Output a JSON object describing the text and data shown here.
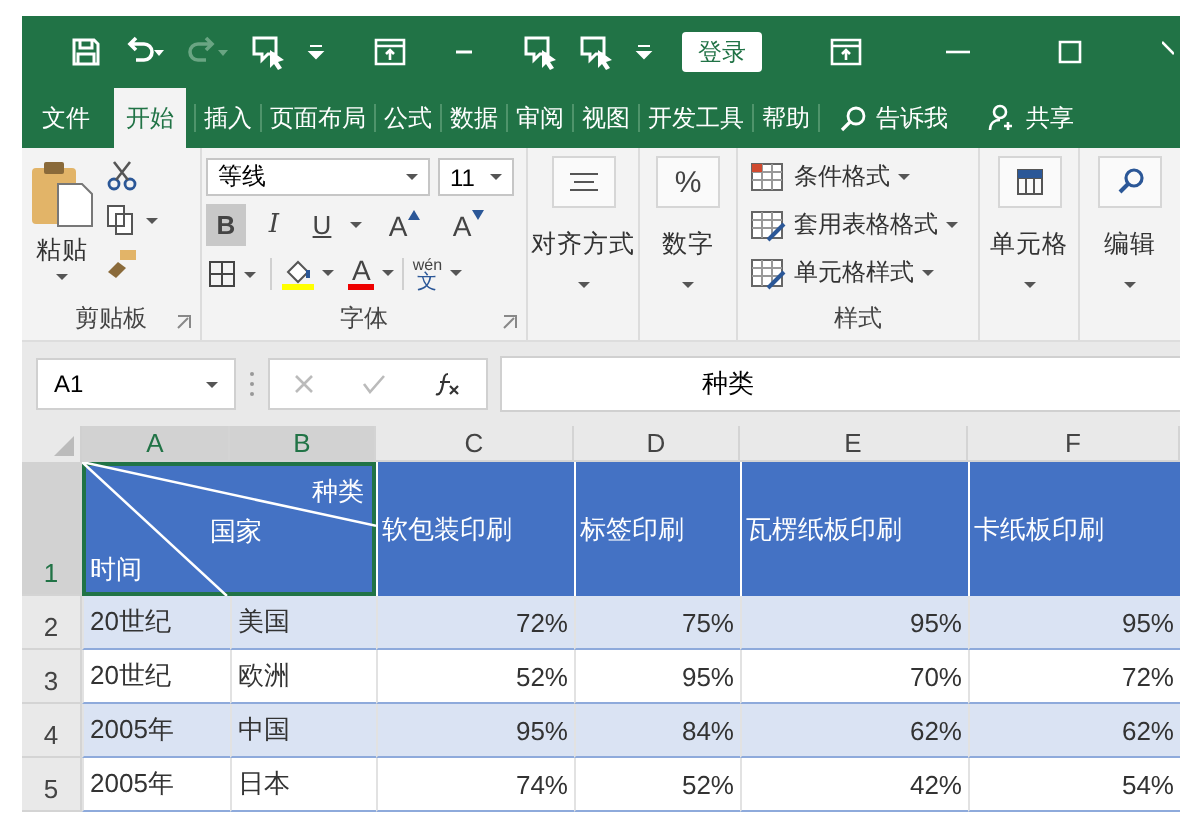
{
  "title_bar": {
    "sign_in": "登录"
  },
  "tabs": [
    {
      "label": "文件",
      "selected": false
    },
    {
      "label": "开始",
      "selected": true
    },
    {
      "label": "插入",
      "selected": false
    },
    {
      "label": "页面布局",
      "selected": false
    },
    {
      "label": "公式",
      "selected": false
    },
    {
      "label": "数据",
      "selected": false
    },
    {
      "label": "审阅",
      "selected": false
    },
    {
      "label": "视图",
      "selected": false
    },
    {
      "label": "开发工具",
      "selected": false
    },
    {
      "label": "帮助",
      "selected": false
    }
  ],
  "tell_me": "告诉我",
  "share": "共享",
  "ribbon": {
    "clipboard": {
      "paste": "粘贴",
      "label": "剪贴板"
    },
    "font": {
      "name": "等线",
      "size": "11",
      "label": "字体",
      "grow": "A",
      "shrink": "A",
      "font_color": "A",
      "phonetic_top": "wén",
      "phonetic_bottom": "文",
      "toggles": [
        {
          "kind": "bold",
          "label": "B",
          "on": true
        },
        {
          "kind": "italic",
          "label": "I",
          "on": false
        },
        {
          "kind": "underline",
          "label": "U",
          "on": false
        }
      ]
    },
    "alignment": "对齐方式",
    "number": "数字",
    "number_icon": "%",
    "styles": {
      "items": [
        "条件格式",
        "套用表格格式",
        "单元格样式"
      ],
      "label": "样式"
    },
    "cells": "单元格",
    "editing": "编辑"
  },
  "formula_bar": {
    "name_box": "A1",
    "content": "种类"
  },
  "sheet": {
    "columns": [
      {
        "label": "A",
        "selected": true
      },
      {
        "label": "B",
        "selected": true
      },
      {
        "label": "C",
        "selected": false
      },
      {
        "label": "D",
        "selected": false
      },
      {
        "label": "E",
        "selected": false
      },
      {
        "label": "F",
        "selected": false
      }
    ],
    "header_row": {
      "number": "1",
      "selected": true,
      "diagonal": {
        "top_right": "种类",
        "middle": "国家",
        "bottom_left": "时间"
      },
      "cells": [
        "软包装印刷",
        "标签印刷",
        "瓦楞纸板印刷",
        "卡纸板印刷"
      ]
    },
    "rows": [
      {
        "number": "2",
        "selected": false,
        "cells": [
          "20世纪",
          "美国",
          "72%",
          "75%",
          "95%",
          "95%"
        ]
      },
      {
        "number": "3",
        "selected": false,
        "cells": [
          "20世纪",
          "欧洲",
          "52%",
          "95%",
          "70%",
          "72%"
        ]
      },
      {
        "number": "4",
        "selected": false,
        "cells": [
          "2005年",
          "中国",
          "95%",
          "84%",
          "62%",
          "62%"
        ]
      },
      {
        "number": "5",
        "selected": false,
        "cells": [
          "2005年",
          "日本",
          "74%",
          "52%",
          "42%",
          "54%"
        ]
      }
    ]
  }
}
